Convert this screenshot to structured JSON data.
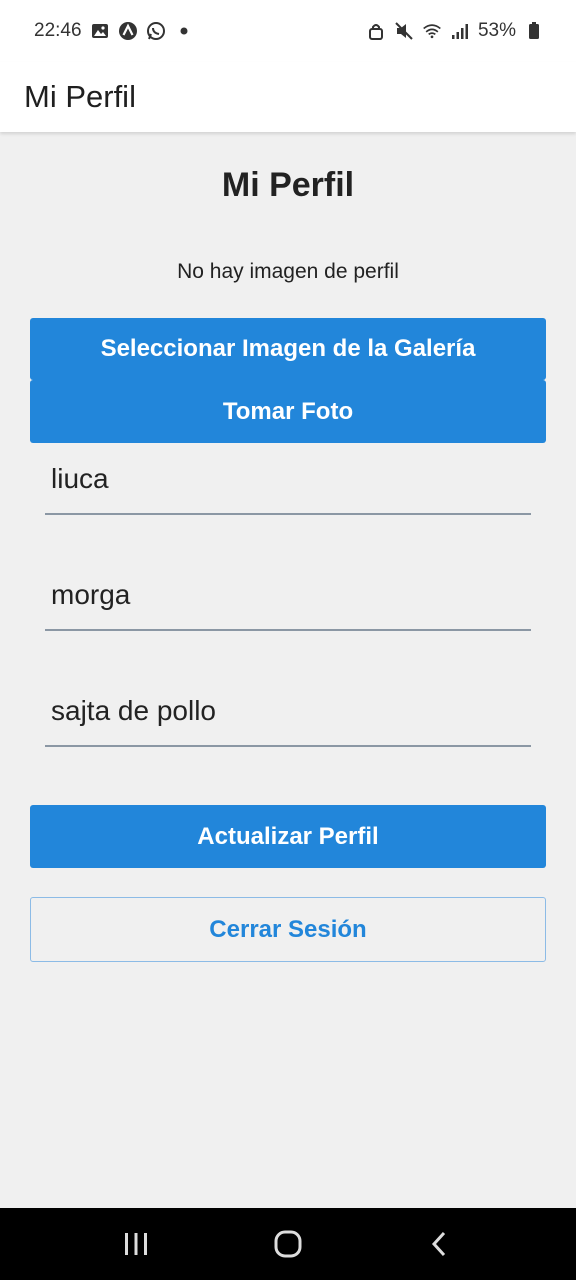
{
  "status_bar": {
    "time": "22:46",
    "battery": "53%",
    "left_icons": [
      "gallery-icon",
      "a-icon",
      "whatsapp-icon",
      "dot-icon"
    ],
    "right_icons": [
      "lock-icon",
      "mute-icon",
      "wifi-icon",
      "signal-icon",
      "battery-icon"
    ]
  },
  "app_bar": {
    "title": "Mi Perfil"
  },
  "page": {
    "title": "Mi Perfil",
    "no_image_text": "No hay imagen de perfil",
    "gallery_button": "Seleccionar Imagen de la Galería",
    "photo_button": "Tomar Foto",
    "fields": [
      {
        "value": "liuca"
      },
      {
        "value": "morga"
      },
      {
        "value": "sajta de pollo"
      }
    ],
    "update_button": "Actualizar Perfil",
    "logout_button": "Cerrar Sesión"
  },
  "colors": {
    "primary": "#2286da",
    "background": "#f0f0f0",
    "underline": "#8b97a4"
  },
  "nav_bar": {
    "icons": [
      "recents-icon",
      "home-icon",
      "back-icon"
    ]
  }
}
